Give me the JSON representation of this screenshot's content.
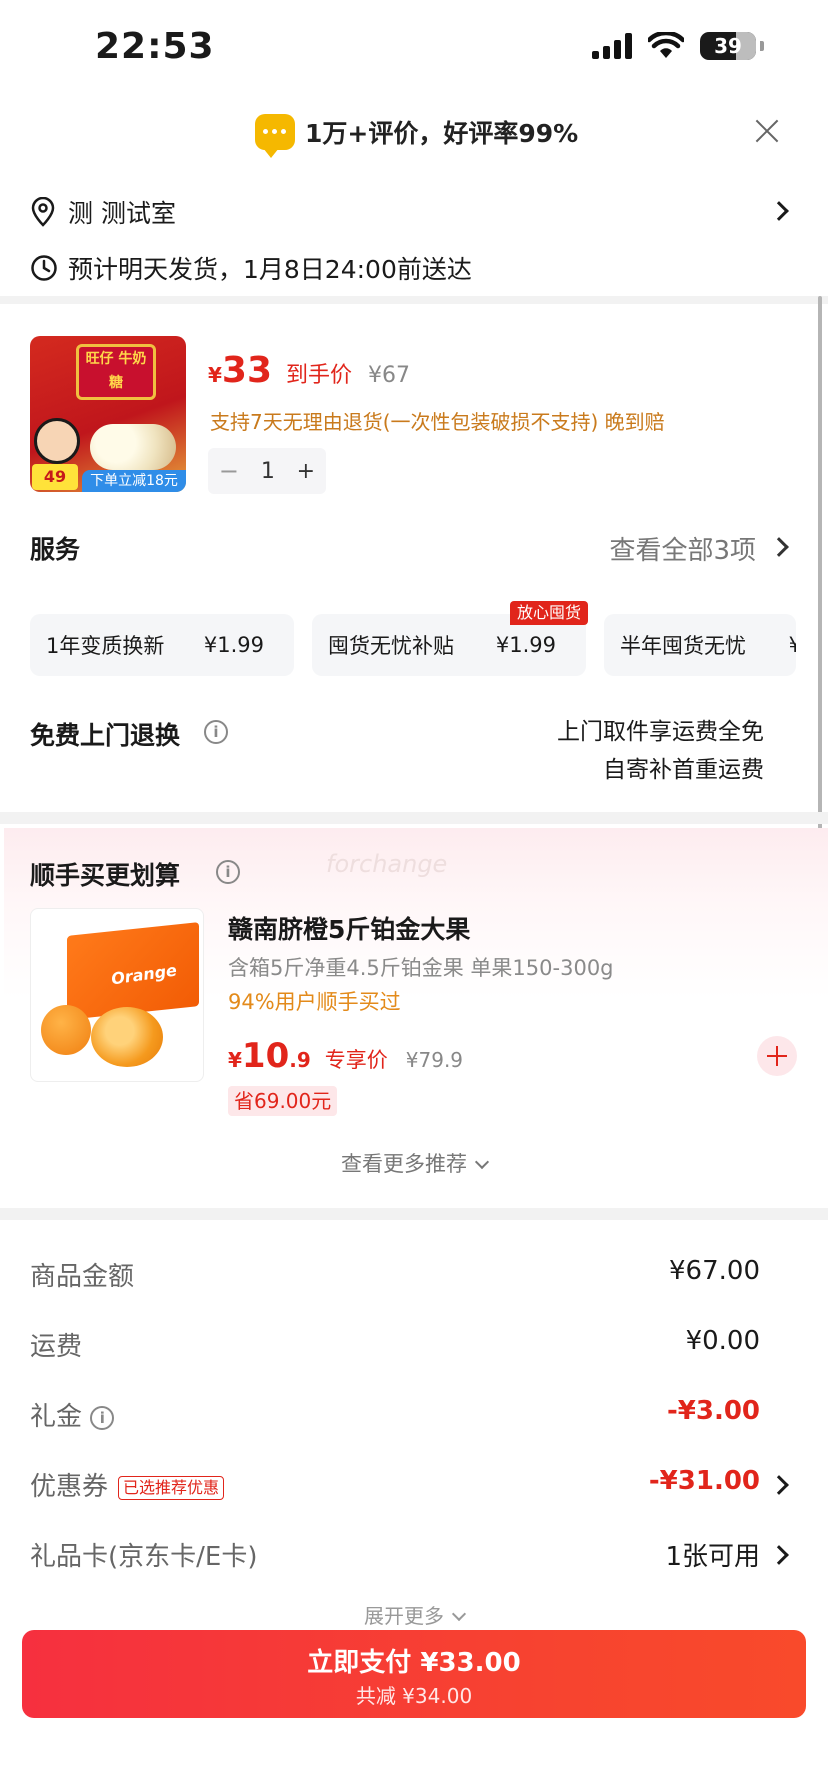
{
  "status_bar": {
    "time": "22:53",
    "battery": "39"
  },
  "banner": {
    "text": "1万+评价，好评率99%"
  },
  "address": {
    "text": "测 测试室"
  },
  "shipping": {
    "text": "预计明天发货，1月8日24:00前送达"
  },
  "product": {
    "price_symbol": "¥",
    "price": "33",
    "price_label": "到手价",
    "original_price": "¥67",
    "return_policy": "支持7天无理由退货(一次性包装破损不支持) 晚到赔",
    "quantity": "1",
    "image_brand": "旺仔 牛奶糖",
    "image_price": "49",
    "image_promo": "下单立减18元"
  },
  "services": {
    "title": "服务",
    "view_all": "查看全部3项",
    "options": [
      {
        "label": "1年变质换新",
        "price": "¥1.99"
      },
      {
        "label": "囤货无忧补贴",
        "price": "¥1.99",
        "tag": "放心囤货"
      },
      {
        "label": "半年囤货无忧",
        "price": "¥"
      }
    ]
  },
  "free_return": {
    "title": "免费上门退换",
    "line1": "上门取件享运费全免",
    "line2": "自寄补首重运费"
  },
  "recommendation": {
    "title": "顺手买更划算",
    "watermark": "forchange",
    "item": {
      "name": "赣南脐橙5斤铂金大果",
      "desc": "含箱5斤净重4.5斤铂金果 单果150-300g",
      "popularity": "94%用户顺手买过",
      "price_symbol": "¥",
      "price_int": "10",
      "price_dec": ".9",
      "price_label": "专享价",
      "original_price": "¥79.9",
      "savings": "省69.00元",
      "image_text": "Orange"
    },
    "more": "查看更多推荐"
  },
  "summary": {
    "rows": [
      {
        "label": "商品金额",
        "value": "¥67.00"
      },
      {
        "label": "运费",
        "value": "¥0.00"
      },
      {
        "label": "礼金",
        "value": "-¥3.00"
      },
      {
        "label": "优惠券",
        "badge": "已选推荐优惠",
        "value": "-¥31.00"
      },
      {
        "label": "礼品卡(京东卡/E卡)",
        "value": "1张可用"
      }
    ],
    "expand": "展开更多"
  },
  "pay": {
    "label": "立即支付 ¥33.00",
    "sub": "共减 ¥34.00"
  },
  "colors": {
    "accent": "#e1251b",
    "orange_text": "#c97a1c",
    "pay_button": "#f6303f"
  }
}
